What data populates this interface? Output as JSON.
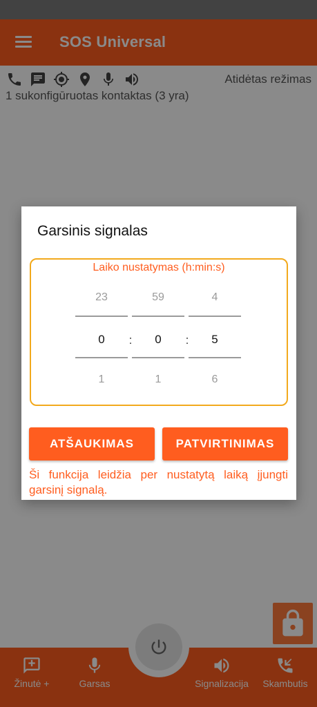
{
  "app": {
    "title": "SOS Universal",
    "mode": "Atidėtas režimas",
    "contacts_status": "1 sukonfigūruotas kontaktas (3 yra)",
    "status_icons": [
      "phone-icon",
      "message-icon",
      "gps-icon",
      "location-pin-icon",
      "microphone-icon",
      "speaker-icon"
    ]
  },
  "dialog": {
    "title": "Garsinis signalas",
    "time_caption": "Laiko nustatymas (h:min:s)",
    "pickers": {
      "hours": {
        "prev": "23",
        "current": "0",
        "next": "1"
      },
      "minutes": {
        "prev": "59",
        "current": "0",
        "next": "1"
      },
      "seconds": {
        "prev": "4",
        "current": "5",
        "next": "6"
      }
    },
    "separator": ":",
    "cancel_label": "ATŠAUKIMAS",
    "confirm_label": "PATVIRTINIMAS",
    "help_text": "Ši funkcija leidžia per nustatytą laiką įjungti garsinį signalą."
  },
  "bottom_nav": {
    "items": [
      {
        "label": "Žinutė +",
        "icon": "add-message-icon"
      },
      {
        "label": "Garsas",
        "icon": "microphone-icon"
      },
      {
        "label": "Signalizacija",
        "icon": "speaker-icon"
      },
      {
        "label": "Skambutis",
        "icon": "incoming-call-icon"
      }
    ],
    "center_icon": "power-icon"
  },
  "colors": {
    "accent": "#ff5d1f",
    "frame": "#f2a91c",
    "scrim": "rgba(0,0,0,0.46)"
  }
}
